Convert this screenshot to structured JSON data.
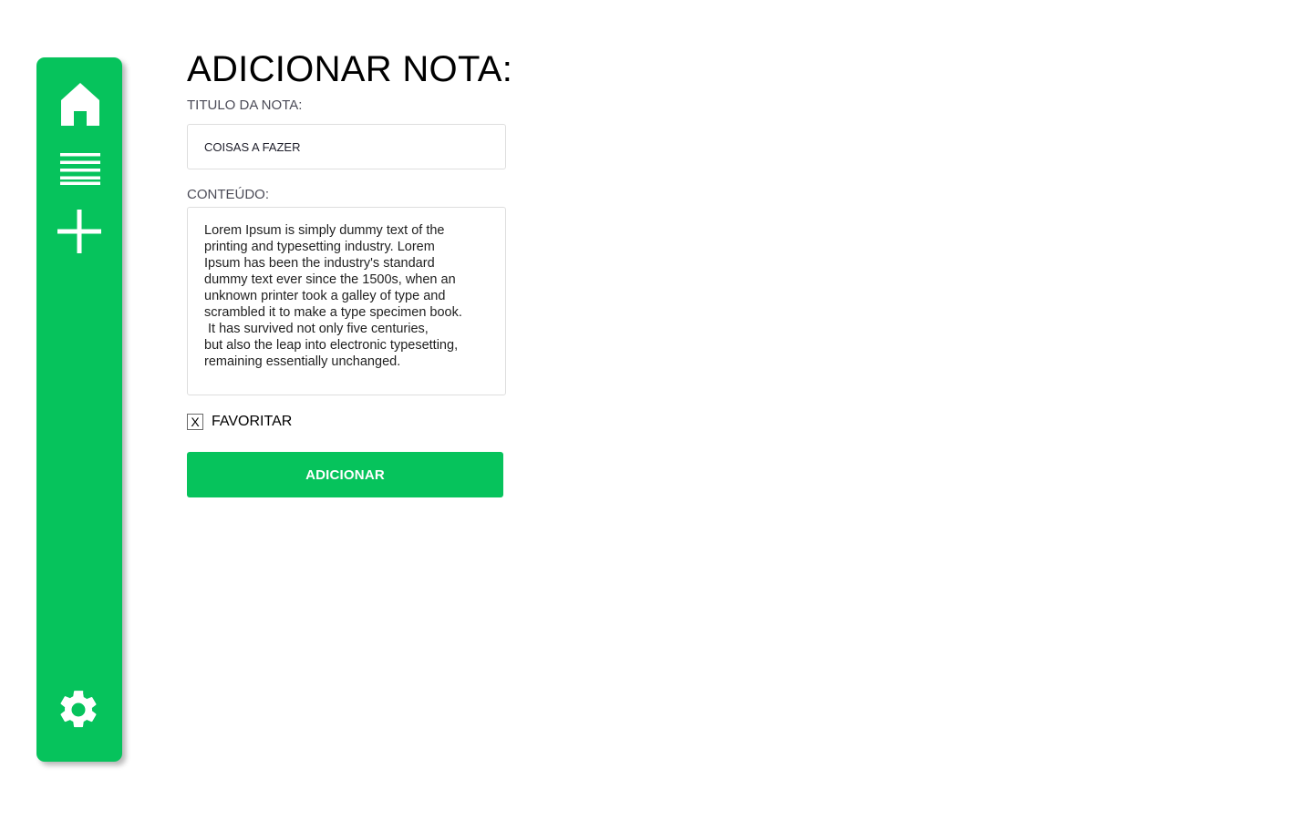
{
  "theme": {
    "accent": "#06c35c",
    "icon_color": "#ffffff"
  },
  "sidebar": {
    "items": [
      {
        "icon": "home-icon"
      },
      {
        "icon": "list-icon"
      },
      {
        "icon": "plus-icon"
      },
      {
        "icon": "gear-icon"
      }
    ]
  },
  "form": {
    "heading": "ADICIONAR NOTA:",
    "title_label": "TITULO DA NOTA:",
    "title_value": "COISAS A FAZER",
    "content_label": "CONTEÚDO:",
    "content_value": "Lorem Ipsum is simply dummy text of the\nprinting and typesetting industry. Lorem\nIpsum has been the industry's standard\ndummy text ever since the 1500s, when an\nunknown printer took a galley of type and\nscrambled it to make a type specimen book.\n It has survived not only five centuries,\nbut also the leap into electronic typesetting,\nremaining essentially unchanged.",
    "favorite_mark": "X",
    "favorite_label": "FAVORITAR",
    "favorite_checked": true,
    "submit_label": "ADICIONAR"
  }
}
